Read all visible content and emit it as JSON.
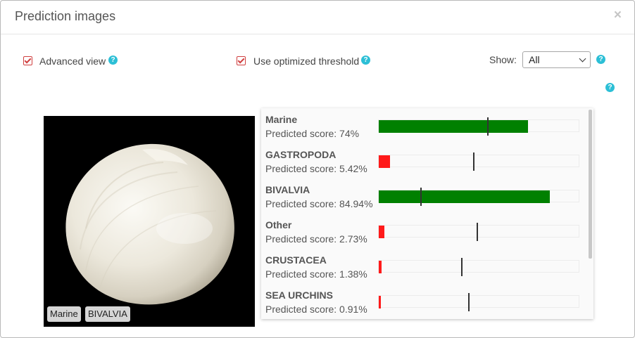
{
  "dialog": {
    "title": "Prediction images",
    "close_label": "×"
  },
  "options": {
    "advanced_view": {
      "label": "Advanced view",
      "checked": true
    },
    "optimized_threshold": {
      "label": "Use optimized threshold",
      "checked": true
    },
    "show": {
      "label": "Show:",
      "selected": "All"
    },
    "help_glyph": "?"
  },
  "image": {
    "tags": [
      "Marine",
      "BIVALVIA"
    ]
  },
  "predictions": [
    {
      "name": "Marine",
      "score_label": "Predicted score: 74%",
      "score": 0.74,
      "threshold": 0.54,
      "status": "pass"
    },
    {
      "name": "GASTROPODA",
      "score_label": "Predicted score: 5.42%",
      "score": 0.0542,
      "threshold": 0.47,
      "status": "fail"
    },
    {
      "name": "BIVALVIA",
      "score_label": "Predicted score: 84.94%",
      "score": 0.8494,
      "threshold": 0.205,
      "status": "pass"
    },
    {
      "name": "Other",
      "score_label": "Predicted score: 2.73%",
      "score": 0.0273,
      "threshold": 0.485,
      "status": "fail"
    },
    {
      "name": "CRUSTACEA",
      "score_label": "Predicted score: 1.38%",
      "score": 0.0138,
      "threshold": 0.41,
      "status": "fail"
    },
    {
      "name": "SEA URCHINS",
      "score_label": "Predicted score: 0.91%",
      "score": 0.0091,
      "threshold": 0.445,
      "status": "fail"
    }
  ],
  "colors": {
    "pass": "#008000",
    "fail": "#ff1a1a",
    "help": "#2cbfd6",
    "checkbox": "#d04040"
  },
  "icons": {
    "close": "close-icon",
    "help": "help-icon",
    "checkbox": "checkbox-checked-icon",
    "dropdown": "chevron-down-icon"
  }
}
